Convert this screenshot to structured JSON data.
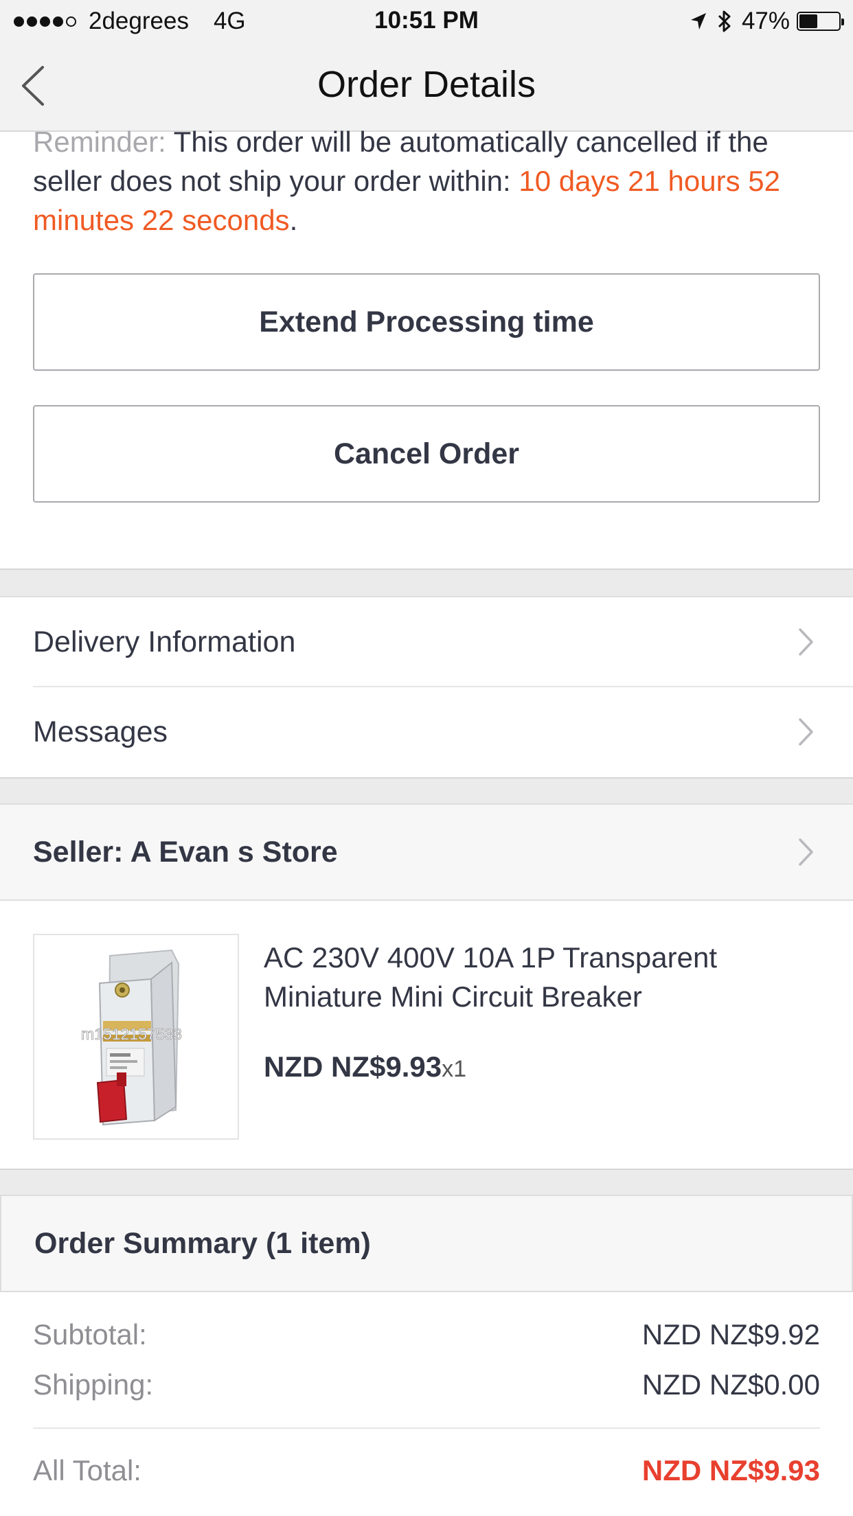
{
  "status_bar": {
    "carrier": "2degrees",
    "network": "4G",
    "time": "10:51 PM",
    "battery_percent": "47%",
    "battery_level": 0.47,
    "signal_bars_filled": 4,
    "signal_bars_total": 5
  },
  "nav": {
    "title": "Order Details",
    "back_icon": "chevron-left-icon"
  },
  "reminder": {
    "label": "Reminder:",
    "text": "This order will be automatically cancelled if the seller does not ship your order within:",
    "countdown": "10 days 21 hours 52 minutes 22 seconds",
    "end": "."
  },
  "actions": {
    "extend_label": "Extend Processing time",
    "cancel_label": "Cancel Order"
  },
  "links": {
    "delivery_label": "Delivery Information",
    "messages_label": "Messages"
  },
  "seller": {
    "label": "Seller: A Evan s Store"
  },
  "product": {
    "title": "AC 230V 400V 10A 1P Transparent Miniature Mini Circuit Breaker",
    "price": "NZD NZ$9.93",
    "quantity": "x1",
    "watermark": "m1512157533"
  },
  "summary": {
    "title": "Order Summary (1 item)",
    "subtotal_label": "Subtotal:",
    "subtotal_value": "NZD NZ$9.92",
    "shipping_label": "Shipping:",
    "shipping_value": "NZD NZ$0.00",
    "total_label": "All Total:",
    "total_value": "NZD NZ$9.93"
  },
  "colors": {
    "accent_orange": "#f05a23",
    "total_red": "#e8402f",
    "text_dark": "#333644",
    "text_muted": "#8e8e93"
  }
}
